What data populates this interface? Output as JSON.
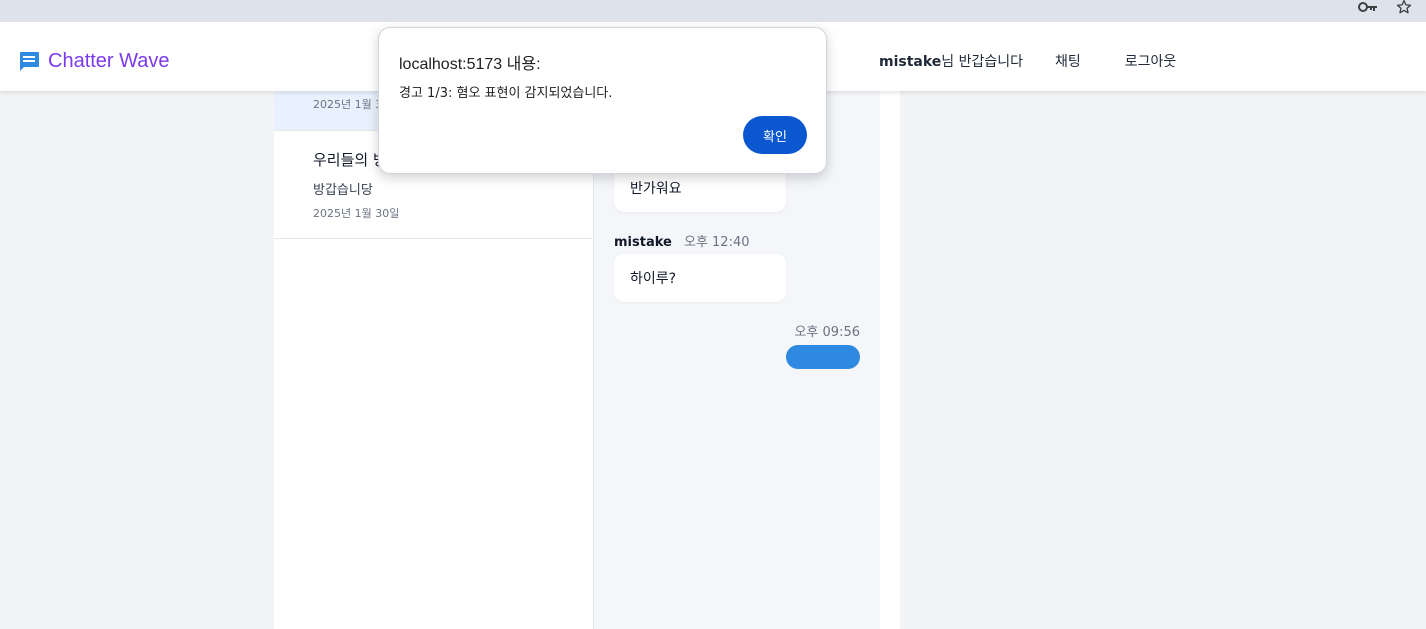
{
  "browser": {
    "icons": [
      "key-icon",
      "star-icon"
    ]
  },
  "navbar": {
    "brand_name": "Chatter Wave",
    "brand_color": "#7c3aed",
    "brand_icon": "chat-bubble-icon",
    "greeting_user": "mistake",
    "greeting_suffix": "님 반갑습니다",
    "chat_link": "채팅",
    "logout_link": "로그아웃"
  },
  "room_list": [
    {
      "title": "",
      "preview": "",
      "date": "2025년 1월 3",
      "active": true
    },
    {
      "title": "우리들의 방",
      "preview": "방갑습니당",
      "date": "2025년 1월 30일",
      "active": false
    }
  ],
  "messages": [
    {
      "sender": "",
      "time": "",
      "text": "반가워요"
    },
    {
      "sender": "mistake",
      "time": "오후 12:40",
      "text": "하이루?"
    }
  ],
  "my_message": {
    "time": "오후 09:56",
    "text": "",
    "bubble_color": "#2e8ae0"
  },
  "dialog": {
    "title": "localhost:5173 내용:",
    "message": "경고 1/3: 혐오 표현이 감지되었습니다.",
    "ok_label": "확인",
    "ok_color": "#0b57d0"
  }
}
